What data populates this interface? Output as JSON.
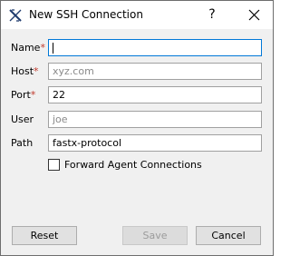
{
  "window": {
    "title": "New SSH Connection",
    "help": "?",
    "app_icon": "fastx-logo-icon",
    "close_icon": "close-icon"
  },
  "form": {
    "name": {
      "label": "Name",
      "required_mark": "*",
      "value": "",
      "placeholder": ""
    },
    "host": {
      "label": "Host",
      "required_mark": "*",
      "value": "",
      "placeholder": "xyz.com"
    },
    "port": {
      "label": "Port",
      "required_mark": "*",
      "value": "22",
      "placeholder": ""
    },
    "user": {
      "label": "User",
      "value": "",
      "placeholder": "joe"
    },
    "path": {
      "label": "Path",
      "value": "fastx-protocol",
      "placeholder": ""
    },
    "forward_agent": {
      "label": "Forward Agent Connections",
      "checked": false
    }
  },
  "buttons": {
    "reset": "Reset",
    "save": "Save",
    "cancel": "Cancel"
  },
  "colors": {
    "required": "#c0392b",
    "focus_border": "#0078d7"
  }
}
